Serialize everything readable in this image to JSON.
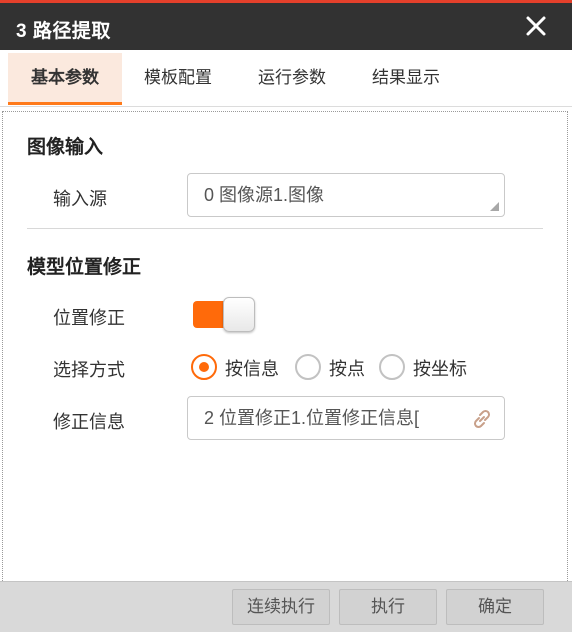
{
  "window": {
    "title": "3 路径提取",
    "accent_color": "#ff6a0a",
    "titlebar_color": "#323232",
    "close_icon": "close-icon"
  },
  "tabs": [
    {
      "label": "基本参数",
      "active": true
    },
    {
      "label": "模板配置",
      "active": false
    },
    {
      "label": "运行参数",
      "active": false
    },
    {
      "label": "结果显示",
      "active": false
    }
  ],
  "image_input": {
    "section_title": "图像输入",
    "source_label": "输入源",
    "source_value": "0 图像源1.图像"
  },
  "position_correction": {
    "section_title": "模型位置修正",
    "toggle_label": "位置修正",
    "toggle_on": true,
    "mode_label": "选择方式",
    "modes": [
      {
        "label": "按信息",
        "checked": true
      },
      {
        "label": "按点",
        "checked": false
      },
      {
        "label": "按坐标",
        "checked": false
      }
    ],
    "info_label": "修正信息",
    "info_value": "2 位置修正1.位置修正信息[",
    "info_icon": "link-icon"
  },
  "footer": {
    "continuous_label": "连续执行",
    "execute_label": "执行",
    "ok_label": "确定"
  }
}
